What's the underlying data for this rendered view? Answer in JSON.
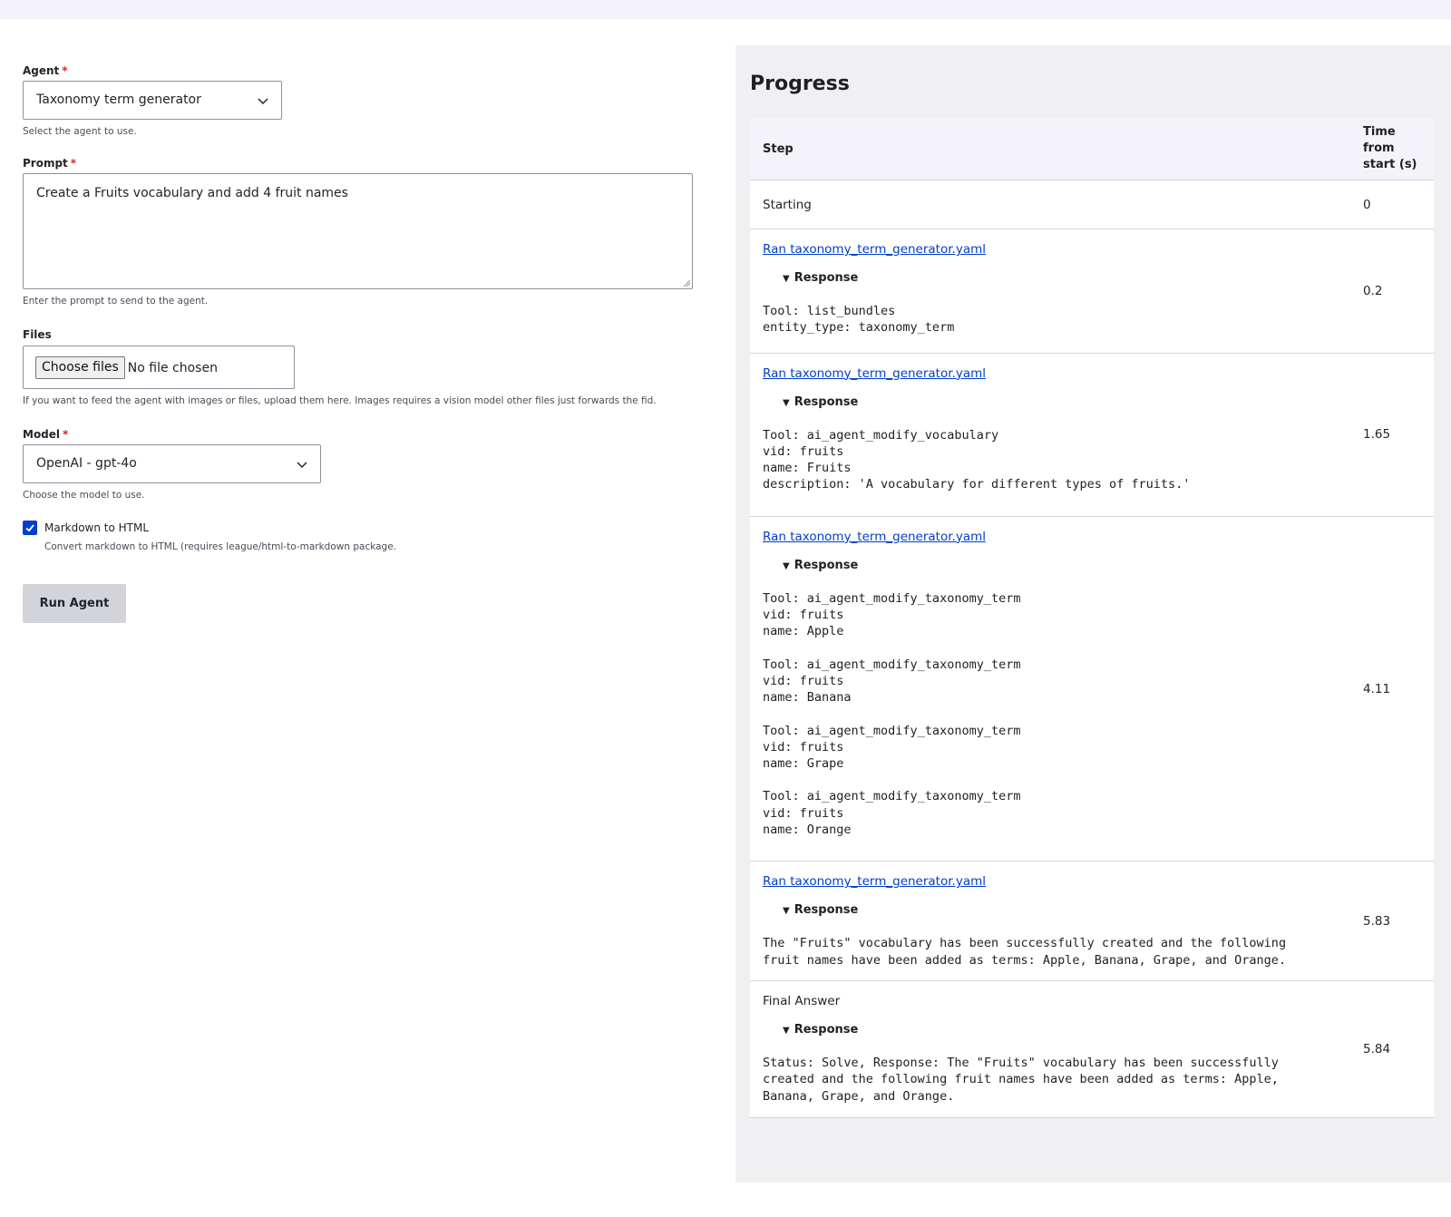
{
  "form": {
    "agent": {
      "label": "Agent",
      "required_mark": "*",
      "value": "Taxonomy term generator",
      "description": "Select the agent to use."
    },
    "prompt": {
      "label": "Prompt",
      "required_mark": "*",
      "value": "Create a Fruits vocabulary and add 4 fruit names",
      "description": "Enter the prompt to send to the agent."
    },
    "files": {
      "label": "Files",
      "button": "Choose files",
      "status": "No file chosen",
      "description": "If you want to feed the agent with images or files, upload them here. Images requires a vision model other files just forwards the fid."
    },
    "model": {
      "label": "Model",
      "required_mark": "*",
      "value": "OpenAI - gpt-4o",
      "description": "Choose the model to use."
    },
    "markdown": {
      "label": "Markdown to HTML",
      "checked": true,
      "description": "Convert markdown to HTML (requires league/html-to-markdown package."
    },
    "run_button": "Run Agent"
  },
  "progress": {
    "title": "Progress",
    "columns": {
      "step": "Step",
      "time_l1": "Time",
      "time_l2": "from",
      "time_l3": "start (s)"
    },
    "rows": [
      {
        "step_text": "Starting",
        "time": "0"
      },
      {
        "link": "Ran taxonomy_term_generator.yaml",
        "summary": "Response",
        "blocks": [
          "Tool: list_bundles\nentity_type: taxonomy_term"
        ],
        "time": "0.2"
      },
      {
        "link": "Ran taxonomy_term_generator.yaml",
        "summary": "Response",
        "blocks": [
          "Tool: ai_agent_modify_vocabulary\nvid: fruits\nname: Fruits\ndescription: 'A vocabulary for different types of fruits.'"
        ],
        "time": "1.65"
      },
      {
        "link": "Ran taxonomy_term_generator.yaml",
        "summary": "Response",
        "blocks": [
          "Tool: ai_agent_modify_taxonomy_term\nvid: fruits\nname: Apple",
          "Tool: ai_agent_modify_taxonomy_term\nvid: fruits\nname: Banana",
          "Tool: ai_agent_modify_taxonomy_term\nvid: fruits\nname: Grape",
          "Tool: ai_agent_modify_taxonomy_term\nvid: fruits\nname: Orange"
        ],
        "time": "4.11"
      },
      {
        "link": "Ran taxonomy_term_generator.yaml",
        "summary": "Response",
        "blocks": [
          "The \"Fruits\" vocabulary has been successfully created and the following\nfruit names have been added as terms: Apple, Banana, Grape, and Orange."
        ],
        "time": "5.83"
      },
      {
        "step_text": "Final Answer",
        "summary": "Response",
        "blocks": [
          "Status: Solve, Response: The \"Fruits\" vocabulary has been successfully\ncreated and the following fruit names have been added as terms: Apple,\nBanana, Grape, and Orange."
        ],
        "time": "5.84"
      }
    ]
  },
  "colors": {
    "link": "#003ecc",
    "required": "#dc2323",
    "checkbox": "#003ecc",
    "panel_bg": "#f0f0f3"
  },
  "icons": {
    "select_arrow": "chevron-down-icon",
    "disclosure": "triangle-down-icon",
    "check": "checkmark-icon"
  }
}
